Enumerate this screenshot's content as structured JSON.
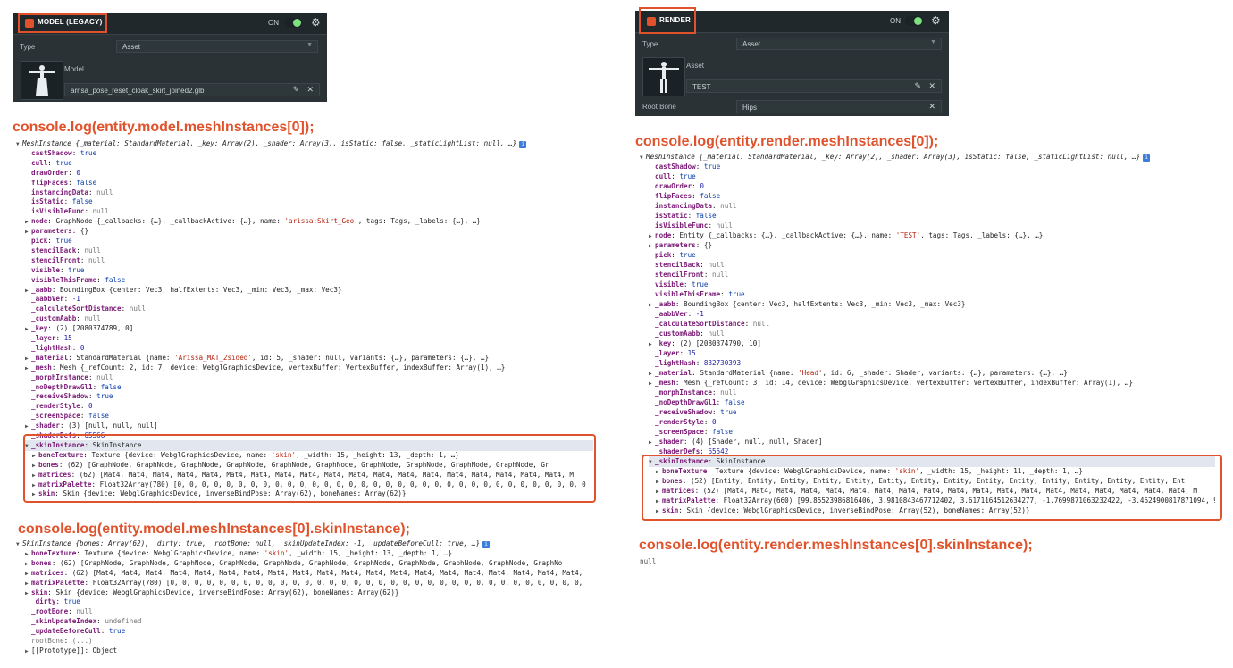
{
  "left_panel": {
    "title": "MODEL (LEGACY)",
    "on_label": "ON",
    "type_label": "Type",
    "type_value": "Asset",
    "model_label": "Model",
    "model_asset": "arrisa_pose_reset_cloak_skirt_joined2.glb"
  },
  "right_panel": {
    "title": "RENDER",
    "on_label": "ON",
    "type_label": "Type",
    "type_value": "Asset",
    "asset_label": "Asset",
    "asset_value": "TEST",
    "root_bone_label": "Root Bone",
    "root_bone_value": "Hips"
  },
  "headings": {
    "left_mesh": "console.log(entity.model.meshInstances[0]);",
    "left_skin": "console.log(entity.model.meshInstances[0].skinInstance);",
    "right_mesh": "console.log(entity.render.meshInstances[0]);",
    "right_skin": "console.log(entity.render.meshInstances[0].skinInstance);"
  },
  "right_skin_output": "null",
  "colors": {
    "accent": "#e0522b",
    "panel_bg": "#2a3235",
    "toggle_on": "#7ee081"
  },
  "left_mesh_lines": [
    {
      "t": "v",
      "h": "MeshInstance {_material: StandardMaterial, _key: Array(2), _shader: Array(3), isStatic: false, _staticLightList: null, …}"
    },
    {
      "k": "castShadow",
      "v": "true",
      "c": "bool"
    },
    {
      "k": "cull",
      "v": "true",
      "c": "bool"
    },
    {
      "k": "drawOrder",
      "v": "0",
      "c": "num"
    },
    {
      "k": "flipFaces",
      "v": "false",
      "c": "bool"
    },
    {
      "k": "instancingData",
      "v": "null",
      "c": "null"
    },
    {
      "k": "isStatic",
      "v": "false",
      "c": "bool"
    },
    {
      "k": "isVisibleFunc",
      "v": "null",
      "c": "null"
    },
    {
      "t": ">",
      "k": "node",
      "v": "GraphNode {_callbacks: {…}, _callbackActive: {…}, name: 'arissa:Skirt_Geo', tags: Tags, _labels: {…}, …}",
      "c": "obj"
    },
    {
      "t": ">",
      "k": "parameters",
      "v": "{}",
      "c": "obj"
    },
    {
      "k": "pick",
      "v": "true",
      "c": "bool"
    },
    {
      "k": "stencilBack",
      "v": "null",
      "c": "null"
    },
    {
      "k": "stencilFront",
      "v": "null",
      "c": "null"
    },
    {
      "k": "visible",
      "v": "true",
      "c": "bool"
    },
    {
      "k": "visibleThisFrame",
      "v": "false",
      "c": "bool"
    },
    {
      "t": ">",
      "k": "_aabb",
      "v": "BoundingBox {center: Vec3, halfExtents: Vec3, _min: Vec3, _max: Vec3}",
      "c": "obj"
    },
    {
      "k": "_aabbVer",
      "v": "-1",
      "c": "num"
    },
    {
      "k": "_calculateSortDistance",
      "v": "null",
      "c": "null"
    },
    {
      "k": "_customAabb",
      "v": "null",
      "c": "null"
    },
    {
      "t": ">",
      "k": "_key",
      "v": "(2) [2080374789, 0]",
      "c": "obj"
    },
    {
      "k": "_layer",
      "v": "15",
      "c": "num"
    },
    {
      "k": "_lightHash",
      "v": "0",
      "c": "num"
    },
    {
      "t": ">",
      "k": "_material",
      "v": "StandardMaterial {name: 'Arissa_MAT_2sided', id: 5, _shader: null, variants: {…}, parameters: {…}, …}",
      "c": "obj"
    },
    {
      "t": ">",
      "k": "_mesh",
      "v": "Mesh {_refCount: 2, id: 7, device: WebglGraphicsDevice, vertexBuffer: VertexBuffer, indexBuffer: Array(1), …}",
      "c": "obj"
    },
    {
      "k": "_morphInstance",
      "v": "null",
      "c": "null"
    },
    {
      "k": "_noDepthDrawGl1",
      "v": "false",
      "c": "bool"
    },
    {
      "k": "_receiveShadow",
      "v": "true",
      "c": "bool"
    },
    {
      "k": "_renderStyle",
      "v": "0",
      "c": "num"
    },
    {
      "k": "_screenSpace",
      "v": "false",
      "c": "bool"
    },
    {
      "t": ">",
      "k": "_shader",
      "v": "(3) [null, null, null]",
      "c": "obj"
    },
    {
      "k": "_shaderDefs",
      "v": "65566",
      "c": "num"
    },
    {
      "t": "v",
      "k": "_skinInstance",
      "v": "SkinInstance",
      "c": "obj",
      "sel": true
    },
    {
      "t": ">",
      "k": "boneTexture",
      "v": "Texture {device: WebglGraphicsDevice, name: 'skin', _width: 15, _height: 13, _depth: 1, …}",
      "c": "obj",
      "i": 1
    },
    {
      "t": ">",
      "k": "bones",
      "v": "(62) [GraphNode, GraphNode, GraphNode, GraphNode, GraphNode, GraphNode, GraphNode, GraphNode, GraphNode, GraphNode, Gr",
      "c": "obj",
      "i": 1
    },
    {
      "t": ">",
      "k": "matrices",
      "v": "(62) [Mat4, Mat4, Mat4, Mat4, Mat4, Mat4, Mat4, Mat4, Mat4, Mat4, Mat4, Mat4, Mat4, Mat4, Mat4, Mat4, Mat4, Mat4, Mat4, M",
      "c": "obj",
      "i": 1
    },
    {
      "t": ">",
      "k": "matrixPalette",
      "v": "Float32Array(780) [0, 0, 0, 0, 0, 0, 0, 0, 0, 0, 0, 0, 0, 0, 0, 0, 0, 0, 0, 0, 0, 0, 0, 0, 0, 0, 0, 0, 0, 0, 0, 0, 0, 0",
      "c": "obj",
      "i": 1
    },
    {
      "t": ">",
      "k": "skin",
      "v": "Skin {device: WebglGraphicsDevice, inverseBindPose: Array(62), boneNames: Array(62)}",
      "c": "obj",
      "i": 1
    }
  ],
  "left_skin_lines": [
    {
      "t": "v",
      "h": "SkinInstance {bones: Array(62), _dirty: true, _rootBone: null, _skinUpdateIndex: -1, _updateBeforeCull: true, …}"
    },
    {
      "t": ">",
      "k": "boneTexture",
      "v": "Texture {device: WebglGraphicsDevice, name: 'skin', _width: 15, _height: 13, _depth: 1, …}",
      "c": "obj"
    },
    {
      "t": ">",
      "k": "bones",
      "v": "(62) [GraphNode, GraphNode, GraphNode, GraphNode, GraphNode, GraphNode, GraphNode, GraphNode, GraphNode, GraphNode, GraphNo",
      "c": "obj"
    },
    {
      "t": ">",
      "k": "matrices",
      "v": "(62) [Mat4, Mat4, Mat4, Mat4, Mat4, Mat4, Mat4, Mat4, Mat4, Mat4, Mat4, Mat4, Mat4, Mat4, Mat4, Mat4, Mat4, Mat4, Mat4, Mat4,",
      "c": "obj"
    },
    {
      "t": ">",
      "k": "matrixPalette",
      "v": "Float32Array(780) [0, 0, 0, 0, 0, 0, 0, 0, 0, 0, 0, 0, 0, 0, 0, 0, 0, 0, 0, 0, 0, 0, 0, 0, 0, 0, 0, 0, 0, 0, 0, 0, 0, 0,",
      "c": "obj"
    },
    {
      "t": ">",
      "k": "skin",
      "v": "Skin {device: WebglGraphicsDevice, inverseBindPose: Array(62), boneNames: Array(62)}",
      "c": "obj"
    },
    {
      "k": "_dirty",
      "v": "true",
      "c": "bool"
    },
    {
      "k": "_rootBone",
      "v": "null",
      "c": "null"
    },
    {
      "k": "_skinUpdateIndex",
      "v": "undefined",
      "c": "null"
    },
    {
      "k": "_updateBeforeCull",
      "v": "true",
      "c": "bool"
    },
    {
      "k": "rootBone",
      "v": "(...)",
      "c": "obj",
      "dim": true
    },
    {
      "t": ">",
      "k": "[[Prototype]]",
      "v": "Object",
      "c": "obj",
      "plain": true
    }
  ],
  "right_mesh_lines": [
    {
      "t": "v",
      "h": "MeshInstance {_material: StandardMaterial, _key: Array(2), _shader: Array(3), isStatic: false, _staticLightList: null, …}"
    },
    {
      "k": "castShadow",
      "v": "true",
      "c": "bool"
    },
    {
      "k": "cull",
      "v": "true",
      "c": "bool"
    },
    {
      "k": "drawOrder",
      "v": "0",
      "c": "num"
    },
    {
      "k": "flipFaces",
      "v": "false",
      "c": "bool"
    },
    {
      "k": "instancingData",
      "v": "null",
      "c": "null"
    },
    {
      "k": "isStatic",
      "v": "false",
      "c": "bool"
    },
    {
      "k": "isVisibleFunc",
      "v": "null",
      "c": "null"
    },
    {
      "t": ">",
      "k": "node",
      "v": "Entity {_callbacks: {…}, _callbackActive: {…}, name: 'TEST', tags: Tags, _labels: {…}, …}",
      "c": "obj"
    },
    {
      "t": ">",
      "k": "parameters",
      "v": "{}",
      "c": "obj"
    },
    {
      "k": "pick",
      "v": "true",
      "c": "bool"
    },
    {
      "k": "stencilBack",
      "v": "null",
      "c": "null"
    },
    {
      "k": "stencilFront",
      "v": "null",
      "c": "null"
    },
    {
      "k": "visible",
      "v": "true",
      "c": "bool"
    },
    {
      "k": "visibleThisFrame",
      "v": "true",
      "c": "bool"
    },
    {
      "t": ">",
      "k": "_aabb",
      "v": "BoundingBox {center: Vec3, halfExtents: Vec3, _min: Vec3, _max: Vec3}",
      "c": "obj"
    },
    {
      "k": "_aabbVer",
      "v": "-1",
      "c": "num"
    },
    {
      "k": "_calculateSortDistance",
      "v": "null",
      "c": "null"
    },
    {
      "k": "_customAabb",
      "v": "null",
      "c": "null"
    },
    {
      "t": ">",
      "k": "_key",
      "v": "(2) [2080374790, 10]",
      "c": "obj"
    },
    {
      "k": "_layer",
      "v": "15",
      "c": "num"
    },
    {
      "k": "_lightHash",
      "v": "832730393",
      "c": "num"
    },
    {
      "t": ">",
      "k": "_material",
      "v": "StandardMaterial {name: 'Head', id: 6, _shader: Shader, variants: {…}, parameters: {…}, …}",
      "c": "obj"
    },
    {
      "t": ">",
      "k": "_mesh",
      "v": "Mesh {_refCount: 3, id: 14, device: WebglGraphicsDevice, vertexBuffer: VertexBuffer, indexBuffer: Array(1), …}",
      "c": "obj"
    },
    {
      "k": "_morphInstance",
      "v": "null",
      "c": "null"
    },
    {
      "k": "_noDepthDrawGl1",
      "v": "false",
      "c": "bool"
    },
    {
      "k": "_receiveShadow",
      "v": "true",
      "c": "bool"
    },
    {
      "k": "_renderStyle",
      "v": "0",
      "c": "num"
    },
    {
      "k": "_screenSpace",
      "v": "false",
      "c": "bool"
    },
    {
      "t": ">",
      "k": "_shader",
      "v": "(4) [Shader, null, null, Shader]",
      "c": "obj"
    },
    {
      "k": "_shaderDefs",
      "v": "65542",
      "c": "num"
    },
    {
      "t": "v",
      "k": "_skinInstance",
      "v": "SkinInstance",
      "c": "obj",
      "sel": true
    },
    {
      "t": ">",
      "k": "boneTexture",
      "v": "Texture {device: WebglGraphicsDevice, name: 'skin', _width: 15, _height: 11, _depth: 1, …}",
      "c": "obj",
      "i": 1
    },
    {
      "t": ">",
      "k": "bones",
      "v": "(52) [Entity, Entity, Entity, Entity, Entity, Entity, Entity, Entity, Entity, Entity, Entity, Entity, Entity, Entity, Ent",
      "c": "obj",
      "i": 1
    },
    {
      "t": ">",
      "k": "matrices",
      "v": "(52) [Mat4, Mat4, Mat4, Mat4, Mat4, Mat4, Mat4, Mat4, Mat4, Mat4, Mat4, Mat4, Mat4, Mat4, Mat4, Mat4, Mat4, Mat4, Mat4, M",
      "c": "obj",
      "i": 1
    },
    {
      "t": ">",
      "k": "matrixPalette",
      "v": "Float32Array(660) [99.85523986816406, 3.9810843467712402, 3.6171164512634277, -1.7699871063232422, -3.4624900817871094, 9",
      "c": "obj",
      "i": 1
    },
    {
      "t": ">",
      "k": "skin",
      "v": "Skin {device: WebglGraphicsDevice, inverseBindPose: Array(52), boneNames: Array(52)}",
      "c": "obj",
      "i": 1
    }
  ]
}
